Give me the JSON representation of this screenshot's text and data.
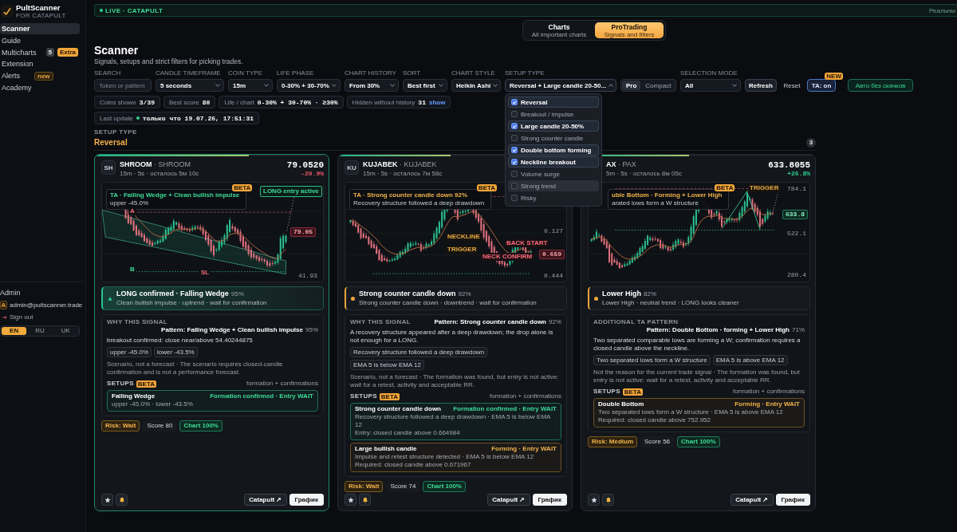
{
  "sidebar": {
    "brand": {
      "name": "PultScanner",
      "tagline": "FOR CATAPULT"
    },
    "nav": [
      {
        "label": "Scanner",
        "selected": true
      },
      {
        "label": "Guide",
        "selected": false
      },
      {
        "label": "Multicharts",
        "selected": false,
        "badges": [
          {
            "text": "5",
            "kind": "count"
          },
          {
            "text": "Extra",
            "kind": "extra"
          }
        ]
      },
      {
        "label": "Extension",
        "selected": false
      },
      {
        "label": "Alerts",
        "selected": false,
        "badges": [
          {
            "text": "new",
            "kind": "new"
          }
        ]
      },
      {
        "label": "Academy",
        "selected": false
      }
    ],
    "section_label": "Admin",
    "user": {
      "avatar": "A",
      "email": "admin@pultscanner.trade"
    },
    "sign_out": "Sign out",
    "languages": [
      {
        "label": "EN",
        "selected": true
      },
      {
        "label": "RU",
        "selected": false
      },
      {
        "label": "UK",
        "selected": false
      }
    ]
  },
  "live_bar": {
    "status": "LIVE · CATAPULT",
    "note": "Реальны"
  },
  "mode_switch": [
    {
      "title": "Charts",
      "subtitle": "All important charts",
      "selected": false
    },
    {
      "title": "ProTrading",
      "subtitle": "Signals and filters",
      "selected": true
    }
  ],
  "page": {
    "title": "Scanner",
    "subtitle": "Signals, setups and strict filters for picking trades."
  },
  "filters": [
    {
      "kind": "input",
      "label": "SEARCH",
      "placeholder": "Token or pattern"
    },
    {
      "kind": "select",
      "label": "CANDLE TIMEFRAME",
      "value": "5 seconds"
    },
    {
      "kind": "select",
      "label": "COIN TYPE",
      "value": "15m"
    },
    {
      "kind": "select",
      "label": "LIFE PHASE",
      "value": "0-30% + 30-70%"
    },
    {
      "kind": "select",
      "label": "CHART HISTORY",
      "value": "From 30%"
    },
    {
      "kind": "select",
      "label": "SORT",
      "value": "Best first"
    },
    {
      "kind": "select",
      "label": "CHART STYLE",
      "value": "Heikin Ashi"
    },
    {
      "kind": "multiselect",
      "label": "SETUP TYPE",
      "value": "Reversal + Large candle 20-50...",
      "expanded": true,
      "options": [
        {
          "label": "Reversal",
          "checked": true,
          "hovered": false
        },
        {
          "label": "Breakout / impulse",
          "checked": false,
          "hovered": false
        },
        {
          "label": "Large candle 20-50%",
          "checked": true,
          "hovered": false
        },
        {
          "label": "Strong counter candle",
          "checked": false,
          "hovered": false
        },
        {
          "label": "Double bottom forming",
          "checked": true,
          "hovered": false
        },
        {
          "label": "Neckline breakout",
          "checked": true,
          "hovered": false
        },
        {
          "label": "Volume surge",
          "checked": false,
          "hovered": false
        },
        {
          "label": "Strong trend",
          "checked": false,
          "hovered": true
        },
        {
          "label": "Risky",
          "checked": false,
          "hovered": false
        }
      ]
    },
    {
      "kind": "segmented",
      "options": [
        {
          "label": "Pro",
          "selected": true
        },
        {
          "label": "Compact",
          "selected": false
        }
      ]
    },
    {
      "kind": "select",
      "label": "SELECTION MODE",
      "value": "All"
    },
    {
      "kind": "button",
      "text": "Refresh"
    },
    {
      "kind": "link-button",
      "text": "Reset"
    },
    {
      "kind": "toggle",
      "text": "TA: on",
      "badge": "NEW"
    },
    {
      "kind": "accent-button",
      "text": "Авто без скачков"
    }
  ],
  "stats": [
    {
      "label": "Coins shown",
      "value": "3/39",
      "live": false
    },
    {
      "label": "Best score",
      "value": "80",
      "live": false
    },
    {
      "label": "Life / chart",
      "value": "0-30% + 30-70% · ≥30%",
      "live": false
    },
    {
      "label": "Hidden without history",
      "value": "31",
      "link": "show",
      "live": false
    },
    {
      "label": "Last update",
      "value": "только что 19.07.26, 17:51:31",
      "live": true
    }
  ],
  "group": {
    "label": "SETUP TYPE",
    "title": "Reversal",
    "count": "3"
  },
  "cards": [
    {
      "avatar": "SH",
      "title": "**SHROOM** · SHROOM",
      "meta": "15m · 5s · осталось 5м 10с",
      "price": "79.0520",
      "change": {
        "text": "-20.9%",
        "kind": "down"
      },
      "highlighted": true,
      "level": 0.66,
      "chart": {
        "kind": "falling-wedge",
        "ta": {
          "kind": "bull",
          "title": "TA · Falling Wedge + Clean bullish impulse",
          "detail": "upper -45.0%",
          "badge": "BETA"
        },
        "labels": [
          {
            "kind": "entry",
            "text": "LONG entry active"
          },
          {
            "kind": "marker-bear",
            "text": "A"
          },
          {
            "kind": "price-bear",
            "text": "79.05"
          },
          {
            "kind": "marker-bull",
            "text": "B"
          },
          {
            "kind": "marker-bear",
            "text": "SL"
          },
          {
            "kind": "axis",
            "text": "41.93"
          }
        ]
      },
      "signal": {
        "kind": "bull",
        "title": "LONG confirmed · Falling Wedge",
        "confidence": "95%",
        "summary": "Clean bullish impulse · uptrend · wait for confirmation"
      },
      "details": {
        "heading": "WHY THIS SIGNAL",
        "pattern": "Pattern: Falling Wedge + Clean bullish impulse",
        "confidence": "95%",
        "text": "breakout confirmed: close near/above 54.40244875",
        "chips": [
          "upper -45.0%",
          "lower -43.5%"
        ],
        "note": "Scenario, not a forecast · The scenario requires closed-candle confirmation and is not a performance forecast.",
        "setups_label": "SETUPS",
        "setups_badge": "BETA",
        "setups_hint": "formation + confirmations",
        "setups": [
          {
            "kind": "confirmed",
            "name": "Falling Wedge",
            "status": "Formation confirmed · Entry WAIT",
            "lines": [
              "upper -45.0% · lower -43.5%"
            ]
          }
        ]
      },
      "tags": [
        {
          "kind": "risk",
          "text": "Risk: Wait"
        },
        {
          "kind": "plain",
          "text": "Score 80"
        },
        {
          "kind": "good",
          "text": "Chart 100%"
        }
      ],
      "actions": {
        "secondary": "Catapult ↗",
        "primary": "График"
      }
    },
    {
      "avatar": "KU",
      "title": "**KUJABEK** · KUJABEK",
      "meta": "15m · 5s · осталось 7м 58с",
      "highlighted": false,
      "level": 0.48,
      "chart": {
        "kind": "counter-candle",
        "ta": {
          "kind": "watch",
          "title": "TA · Strong counter candle down 92%",
          "detail": "Recovery structure followed a deep drawdown",
          "badge": "BETA"
        },
        "labels": [
          {
            "kind": "axis",
            "text": "0.127"
          },
          {
            "kind": "level",
            "text": "NECKLINE"
          },
          {
            "kind": "note",
            "text": "BACK START"
          },
          {
            "kind": "level",
            "text": "TRIGGER"
          },
          {
            "kind": "note",
            "text": "NECK CONFIRM"
          },
          {
            "kind": "price-bear",
            "text": "0.659"
          },
          {
            "kind": "axis",
            "text": "0.444"
          }
        ]
      },
      "signal": {
        "kind": "watch",
        "title": "Strong counter candle down",
        "confidence": "92%",
        "summary": "Strong counter candle down · downtrend · wait for confirmation"
      },
      "details": {
        "heading": "WHY THIS SIGNAL",
        "pattern": "Pattern: Strong counter candle down",
        "confidence": "92%",
        "text": "A recovery structure appeared after a deep drawdown; the drop alone is not enough for a LONG.",
        "chips": [
          "Recovery structure followed a deep drawdown",
          "EMA 5 is below EMA 12"
        ],
        "note": "Scenario, not a forecast · The formation was found, but entry is not active: wait for a retest, activity and acceptable RR.",
        "setups_label": "SETUPS",
        "setups_badge": "BETA",
        "setups_hint": "formation + confirmations",
        "setups": [
          {
            "kind": "confirmed",
            "name": "Strong counter candle down",
            "status": "Formation confirmed · Entry WAIT",
            "lines": [
              "Recovery structure followed a deep drawdown · EMA 5 is below EMA 12",
              "Entry: closed candle above 0.664984"
            ]
          },
          {
            "kind": "forming",
            "name": "Large bullish candle",
            "status": "Forming · Entry WAIT",
            "lines": [
              "Impulse and retest structure detected · EMA 5 is below EMA 12",
              "Required: closed candle above 0.671967"
            ]
          }
        ]
      },
      "tags": [
        {
          "kind": "risk",
          "text": "Risk: Wait"
        },
        {
          "kind": "plain",
          "text": "Score 74"
        },
        {
          "kind": "good",
          "text": "Chart 100%"
        }
      ],
      "actions": {
        "secondary": "Catapult ↗",
        "primary": "График"
      }
    },
    {
      "title": "**AX** · PAX",
      "meta": "5m · 5s · осталось 8м 05с",
      "price": "633.8055",
      "change": {
        "text": "+26.8%",
        "kind": "up"
      },
      "highlighted": false,
      "level": 0.46,
      "chart": {
        "kind": "double-bottom",
        "ta": {
          "kind": "watch",
          "title": "uble Bottom · Forming + Lower High",
          "detail": "arated lows form a W structure",
          "badge": "BETA"
        },
        "labels": [
          {
            "kind": "level",
            "text": "TRIGGER"
          },
          {
            "kind": "axis",
            "text": "784.1"
          },
          {
            "kind": "price-bull",
            "text": "633.8"
          },
          {
            "kind": "axis",
            "text": "522.1"
          },
          {
            "kind": "axis",
            "text": "280.4"
          }
        ]
      },
      "signal": {
        "kind": "watch",
        "title": "Lower High",
        "confidence": "82%",
        "summary": "Lower High · neutral trend · LONG looks cleaner"
      },
      "details": {
        "heading": "ADDITIONAL TA PATTERN",
        "pattern": "Pattern: Double Bottom · forming + Lower High",
        "confidence": "71%",
        "text": "Two separated comparable lows are forming a W; confirmation requires a closed candle above the neckline.",
        "chips": [
          "Two separated lows form a W structure",
          "EMA 5 is above EMA 12"
        ],
        "note": "Not the reason for the current trade signal · The formation was found, but entry is not active: wait for a retest, activity and acceptable RR.",
        "setups_label": "SETUPS",
        "setups_badge": "BETA",
        "setups_hint": "formation + confirmations",
        "setups": [
          {
            "kind": "forming",
            "name": "Double Bottom",
            "status": "Forming · Entry WAIT",
            "lines": [
              "Two separated lows form a W structure · EMA 5 is above EMA 12",
              "Required: closed candle above 752.952"
            ]
          }
        ]
      },
      "tags": [
        {
          "kind": "risk",
          "text": "Risk: Medium"
        },
        {
          "kind": "plain",
          "text": "Score 56"
        },
        {
          "kind": "good",
          "text": "Chart 100%"
        }
      ],
      "actions": {
        "secondary": "Catapult ↗",
        "primary": "График"
      }
    }
  ]
}
